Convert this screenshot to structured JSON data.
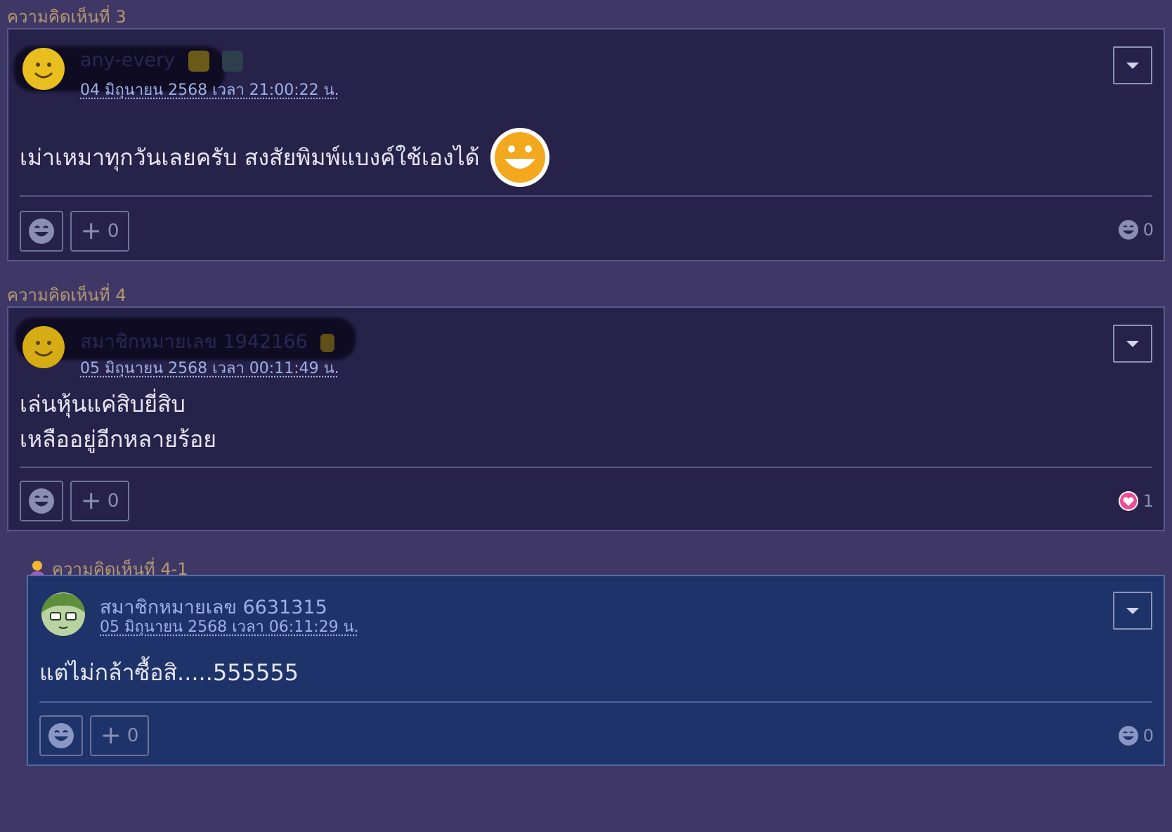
{
  "colors": {
    "page_bg": "#3f3765",
    "card_bg": "#26224a",
    "reply_bg": "#1d336a",
    "heading": "#b39a72",
    "meta_text": "#9fb0e4",
    "body_text": "#e6e6f2"
  },
  "comments": [
    {
      "heading": "ความคิดเห็นที่ 3",
      "username": "any-every",
      "timestamp": "04 มิถุนายน 2568 เวลา 21:00:22 น.",
      "body_lines": [
        "เม่าเหมาทุกวันเลยครับ สงสัยพิมพ์แบงค์ใช้เองได้"
      ],
      "plus_count": "0",
      "reaction_icon": "laugh-icon",
      "reaction_count": "0"
    },
    {
      "heading": "ความคิดเห็นที่ 4",
      "username": "สมาชิกหมายเลข 1942166",
      "timestamp": "05 มิถุนายน 2568 เวลา 00:11:49 น.",
      "body_lines": [
        "เล่นหุ้นแค่สิบยี่สิบ",
        "เหลืออยู่อีกหลายร้อย"
      ],
      "plus_count": "0",
      "reaction_icon": "heart-icon",
      "reaction_count": "1"
    }
  ],
  "reply": {
    "heading": "ความคิดเห็นที่ 4-1",
    "username": "สมาชิกหมายเลข 6631315",
    "timestamp": "05 มิถุนายน 2568 เวลา 06:11:29 น.",
    "body_lines": [
      "แต่ไม่กล้าซื้อสิ.....555555"
    ],
    "plus_count": "0",
    "reaction_icon": "laugh-icon",
    "reaction_count": "0"
  }
}
